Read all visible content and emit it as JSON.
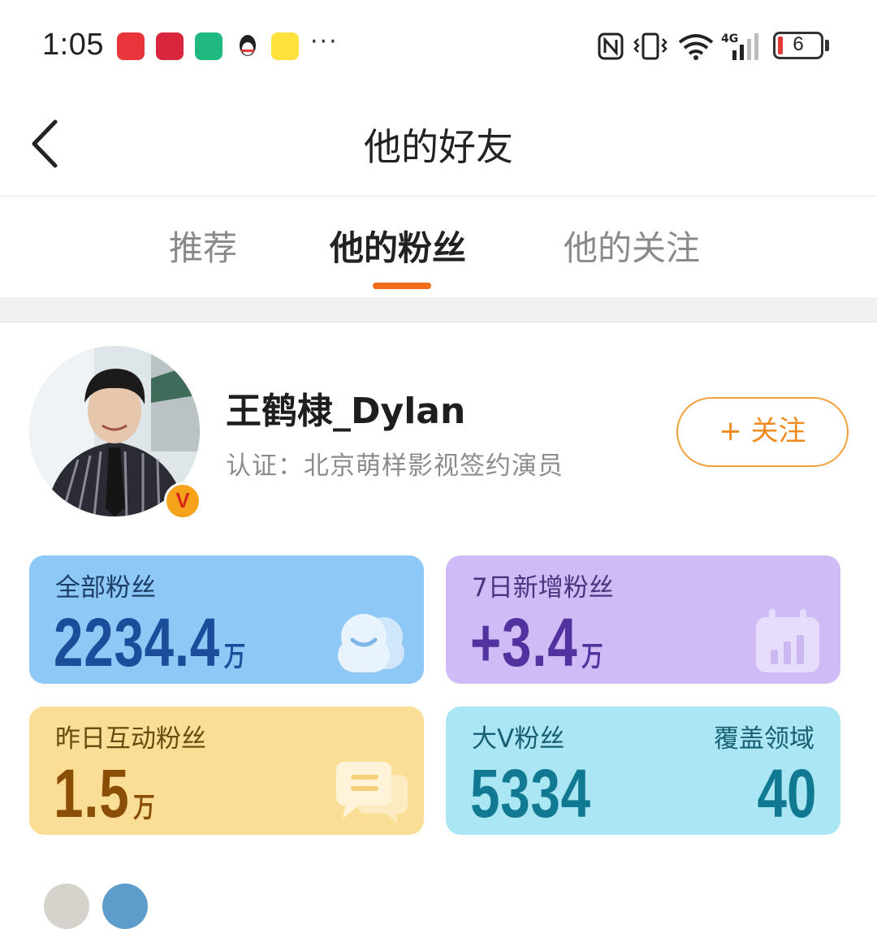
{
  "status_bar": {
    "time": "1:05",
    "battery": "6",
    "network": "4G"
  },
  "header": {
    "title": "他的好友"
  },
  "tabs": [
    {
      "label": "推荐",
      "active": false
    },
    {
      "label": "他的粉丝",
      "active": true
    },
    {
      "label": "他的关注",
      "active": false
    }
  ],
  "profile": {
    "name": "王鹤棣_Dylan",
    "certification": "认证：北京萌样影视签约演员",
    "verified_badge": "V",
    "follow_label": "+ 关注"
  },
  "stats": {
    "all_fans": {
      "label": "全部粉丝",
      "value": "2234.4",
      "unit": "万"
    },
    "new_fans_7d": {
      "label": "7日新增粉丝",
      "value": "+3.4",
      "unit": "万"
    },
    "interactive_yesterday": {
      "label": "昨日互动粉丝",
      "value": "1.5",
      "unit": "万"
    },
    "big_v_fans": {
      "label": "大V粉丝",
      "value": "5334",
      "coverage_label": "覆盖领域",
      "coverage_value": "40"
    }
  },
  "colors": {
    "accent": "#f26c1a",
    "follow_border": "#f0a03c"
  }
}
